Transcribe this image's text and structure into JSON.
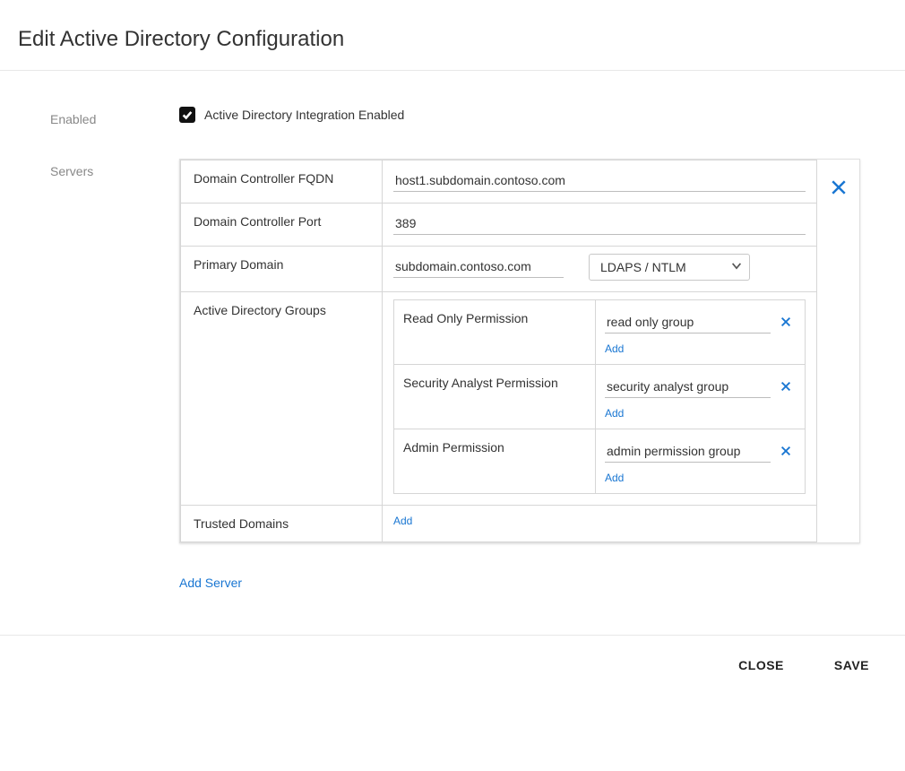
{
  "page": {
    "title": "Edit Active Directory Configuration"
  },
  "form": {
    "enabled_label": "Enabled",
    "enabled_checkbox_label": "Active Directory Integration Enabled",
    "servers_label": "Servers",
    "add_server_label": "Add Server"
  },
  "server": {
    "fqdn_label": "Domain Controller FQDN",
    "fqdn_value": "host1.subdomain.contoso.com",
    "port_label": "Domain Controller Port",
    "port_value": "389",
    "primary_domain_label": "Primary Domain",
    "primary_domain_value": "subdomain.contoso.com",
    "auth_method": "LDAPS / NTLM",
    "groups_label": "Active Directory Groups",
    "groups": {
      "read_only": {
        "label": "Read Only Permission",
        "value": "read only group",
        "add": "Add"
      },
      "analyst": {
        "label": "Security Analyst Permission",
        "value": "security analyst group",
        "add": "Add"
      },
      "admin": {
        "label": "Admin Permission",
        "value": "admin permission group",
        "add": "Add"
      }
    },
    "trusted_domains_label": "Trusted Domains",
    "trusted_domains_add": "Add"
  },
  "footer": {
    "close": "CLOSE",
    "save": "SAVE"
  }
}
